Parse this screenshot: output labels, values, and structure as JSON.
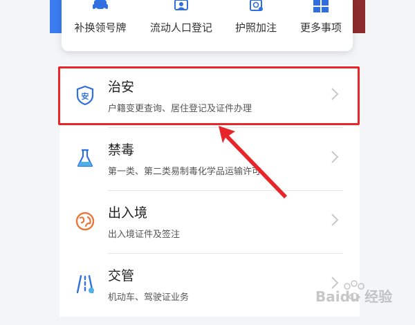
{
  "quick_actions": [
    {
      "label": "补换领号牌",
      "icon": "car-icon"
    },
    {
      "label": "流动人口登记",
      "icon": "id-card-icon"
    },
    {
      "label": "护照加注",
      "icon": "passport-icon"
    },
    {
      "label": "更多事项",
      "icon": "grid-icon"
    }
  ],
  "services": [
    {
      "title": "治安",
      "subtitle": "户籍变更查询、居住登记及证件办理",
      "icon": "shield-an-icon"
    },
    {
      "title": "禁毒",
      "subtitle": "第一类、第二类易制毒化学品运输许可",
      "icon": "flask-icon"
    },
    {
      "title": "出入境",
      "subtitle": "出入境证件及签注",
      "icon": "globe-icon"
    },
    {
      "title": "交管",
      "subtitle": "机动车、驾驶证业务",
      "icon": "road-icon"
    }
  ],
  "shield_icon_char": "安",
  "watermark_text": "Baidu 经验",
  "colors": {
    "accent_blue": "#2f6fe0",
    "highlight_red": "#e8262a",
    "globe_orange": "#e8783a"
  }
}
